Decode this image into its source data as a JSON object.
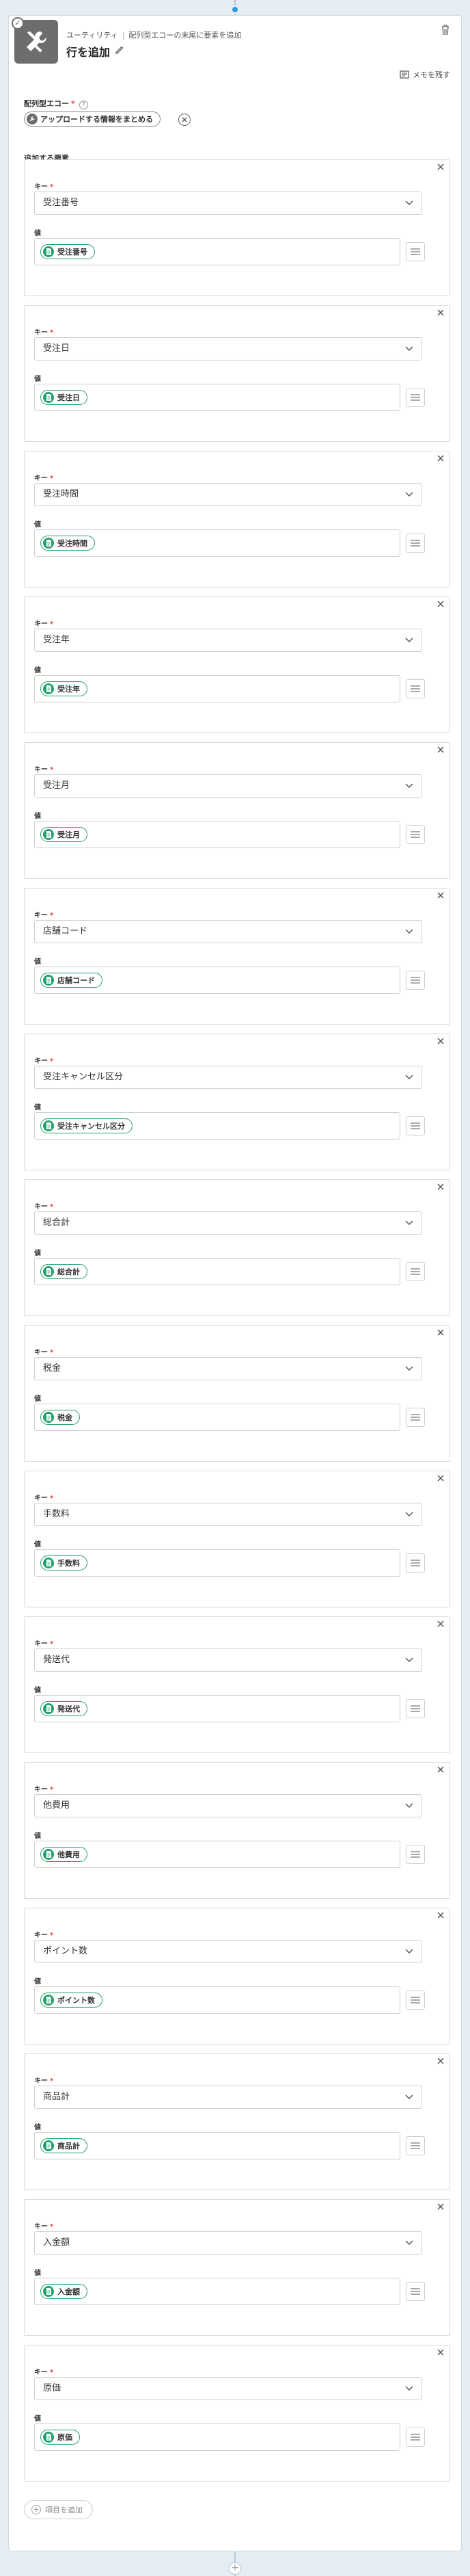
{
  "header": {
    "breadcrumb_app": "ユーティリティ",
    "breadcrumb_action": "配列型エコーの末尾に要素を追加",
    "title": "行を追加"
  },
  "memo_label": "メモを残す",
  "array_field": {
    "label": "配列型エコー",
    "required_mark": "*",
    "help": "?",
    "chip_label": "アップロードする情報をまとめる"
  },
  "items_section_label": "追加する要素",
  "key_label": "キー",
  "required_mark": "*",
  "value_label": "値",
  "items": [
    {
      "key": "受注番号",
      "value": "受注番号"
    },
    {
      "key": "受注日",
      "value": "受注日"
    },
    {
      "key": "受注時間",
      "value": "受注時間"
    },
    {
      "key": "受注年",
      "value": "受注年"
    },
    {
      "key": "受注月",
      "value": "受注月"
    },
    {
      "key": "店舗コード",
      "value": "店舗コード"
    },
    {
      "key": "受注キャンセル区分",
      "value": "受注キャンセル区分"
    },
    {
      "key": "総合計",
      "value": "総合計"
    },
    {
      "key": "税金",
      "value": "税金"
    },
    {
      "key": "手数料",
      "value": "手数料"
    },
    {
      "key": "発送代",
      "value": "発送代"
    },
    {
      "key": "他費用",
      "value": "他費用"
    },
    {
      "key": "ポイント数",
      "value": "ポイント数"
    },
    {
      "key": "商品計",
      "value": "商品計"
    },
    {
      "key": "入金額",
      "value": "入金額"
    },
    {
      "key": "原価",
      "value": "原価"
    }
  ],
  "add_item_label": "項目を追加",
  "colors": {
    "accent_green": "#27a06e",
    "module_gray": "#6d6d6d",
    "background": "#e4edf3",
    "connector_dot": "#2f9bd6"
  }
}
